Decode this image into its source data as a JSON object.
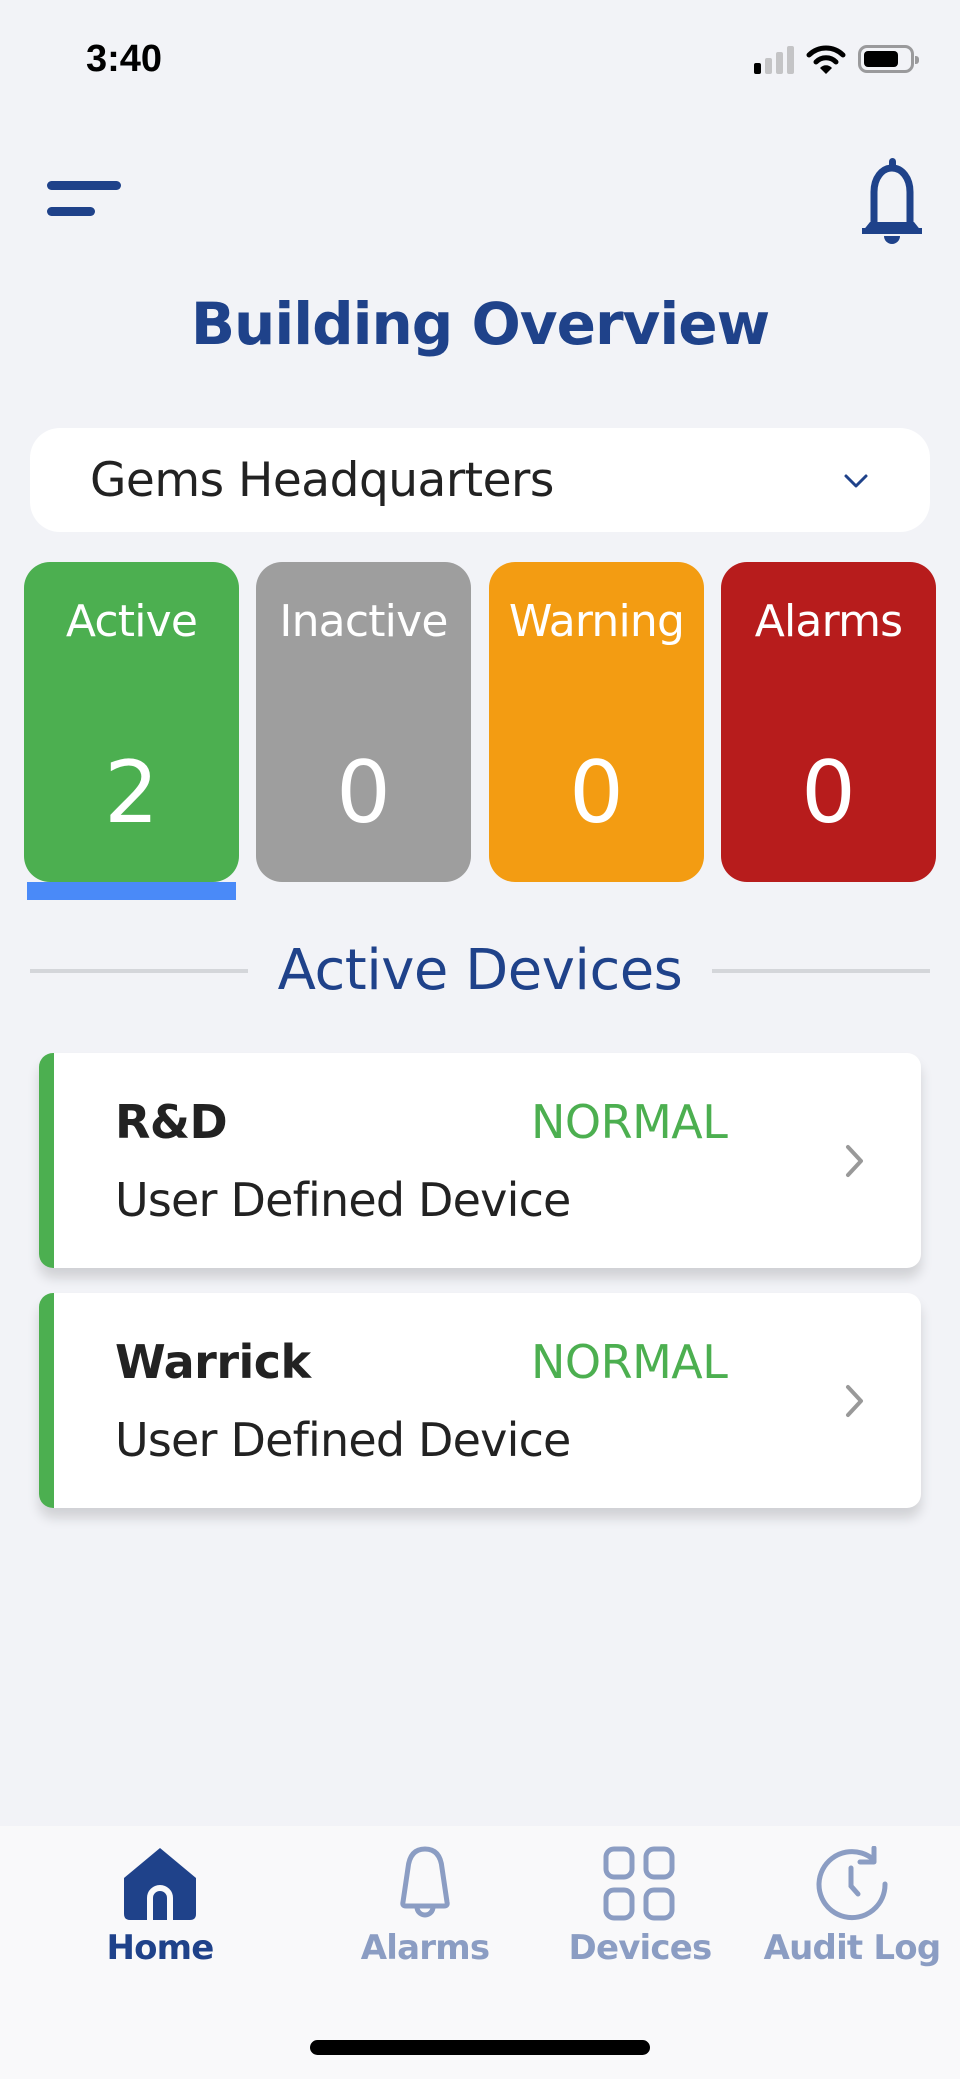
{
  "status_bar": {
    "time": "3:40",
    "signal_bars_active": 1,
    "signal_bars_total": 4,
    "battery_level_fraction": 0.78
  },
  "header": {
    "title": "Building Overview",
    "menu_icon": "menu-icon",
    "notifications_icon": "bell-icon"
  },
  "building_selector": {
    "selected": "Gems Headquarters",
    "icon": "chevron-down-icon"
  },
  "summary_tiles": [
    {
      "label": "Active",
      "count": "2",
      "color": "#4caf50",
      "selected": true
    },
    {
      "label": "Inactive",
      "count": "0",
      "color": "#9e9e9e",
      "selected": false
    },
    {
      "label": "Warning",
      "count": "0",
      "color": "#f39c12",
      "selected": false
    },
    {
      "label": "Alarms",
      "count": "0",
      "color": "#b71c1c",
      "selected": false
    }
  ],
  "selected_indicator_color": "#4a8af8",
  "section": {
    "title": "Active Devices"
  },
  "devices": [
    {
      "name": "R&D",
      "status": "NORMAL",
      "type": "User Defined Device",
      "status_color": "#4caf50"
    },
    {
      "name": "Warrick",
      "status": "NORMAL",
      "type": "User Defined Device",
      "status_color": "#4caf50"
    }
  ],
  "tabbar": {
    "items": [
      {
        "label": "Home",
        "icon": "home-icon",
        "active": true
      },
      {
        "label": "Alarms",
        "icon": "bell-icon",
        "active": false
      },
      {
        "label": "Devices",
        "icon": "grid-icon",
        "active": false
      },
      {
        "label": "Audit Log",
        "icon": "history-icon",
        "active": false
      }
    ]
  },
  "colors": {
    "brand": "#1f428a",
    "tab_inactive": "#8b9dc3",
    "background": "#f2f3f7"
  }
}
